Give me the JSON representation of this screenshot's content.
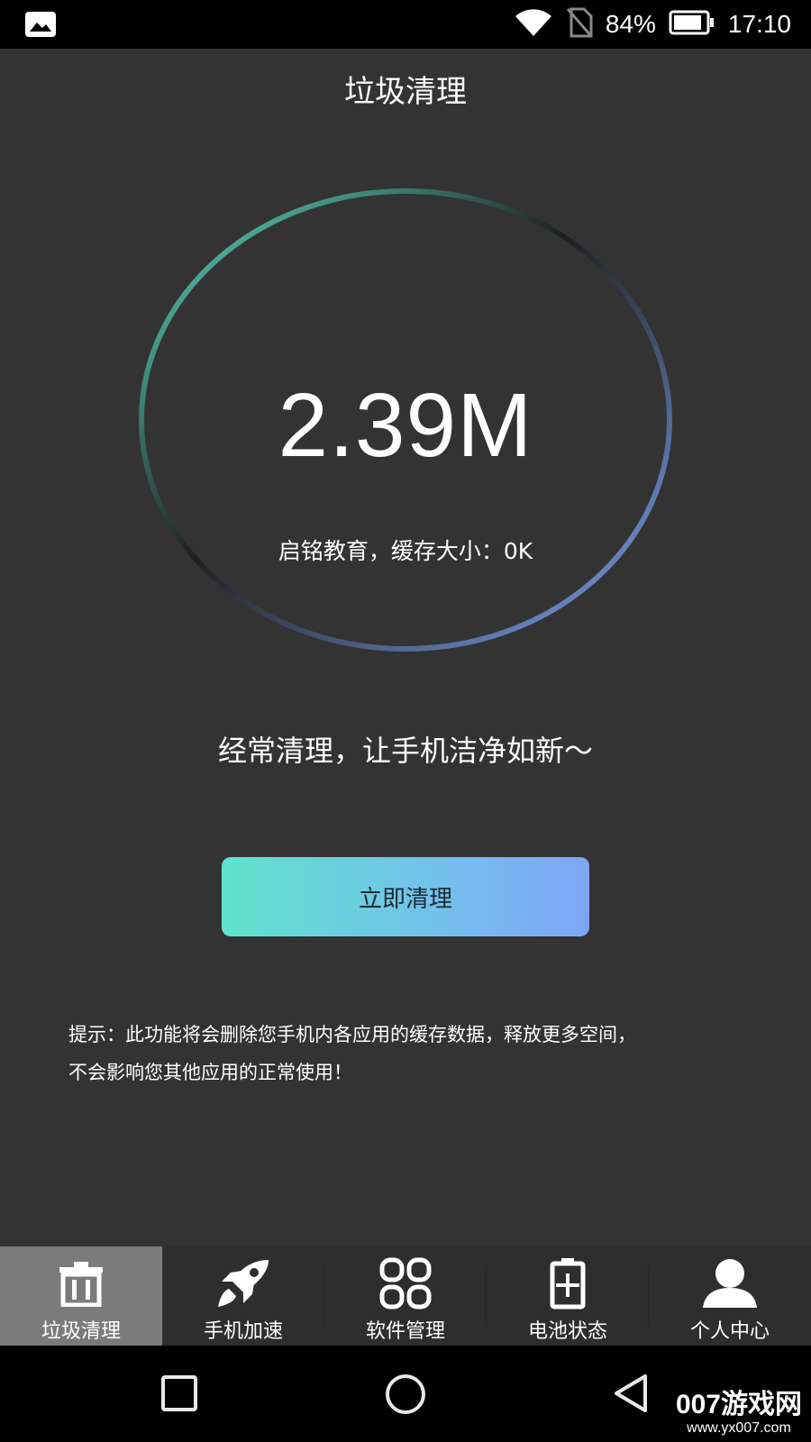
{
  "status_bar": {
    "left_icon": "image-notification-icon",
    "icons": [
      "wifi-icon",
      "no-sim-icon",
      "battery-icon"
    ],
    "battery_percent": "84%",
    "time": "17:10"
  },
  "header": {
    "title": "垃圾清理"
  },
  "meter": {
    "size": "2.39M",
    "cache_info": "启铭教育，缓存大小：0K",
    "ring_colors": {
      "start": "#5fe3cd",
      "mid": "#2a2a2a",
      "end": "#7fa6f5"
    }
  },
  "slogan": "经常清理，让手机洁净如新～",
  "clean_button": {
    "label": "立即清理",
    "gradient": [
      "#5fe3cd",
      "#7fa6f5"
    ]
  },
  "tip": {
    "line1": "提示：此功能将会删除您手机内各应用的缓存数据，释放更多空间，",
    "line2": "不会影响您其他应用的正常使用！"
  },
  "tabs": [
    {
      "label": "垃圾清理",
      "icon": "trash-icon",
      "active": true
    },
    {
      "label": "手机加速",
      "icon": "rocket-icon",
      "active": false
    },
    {
      "label": "软件管理",
      "icon": "apps-grid-icon",
      "active": false
    },
    {
      "label": "电池状态",
      "icon": "battery-plus-icon",
      "active": false
    },
    {
      "label": "个人中心",
      "icon": "user-icon",
      "active": false
    }
  ],
  "nav_bar": {
    "buttons": [
      "recents-icon",
      "home-icon",
      "back-icon"
    ]
  },
  "watermark": {
    "line1": "007游戏网",
    "line2": "www.yx007.com"
  }
}
